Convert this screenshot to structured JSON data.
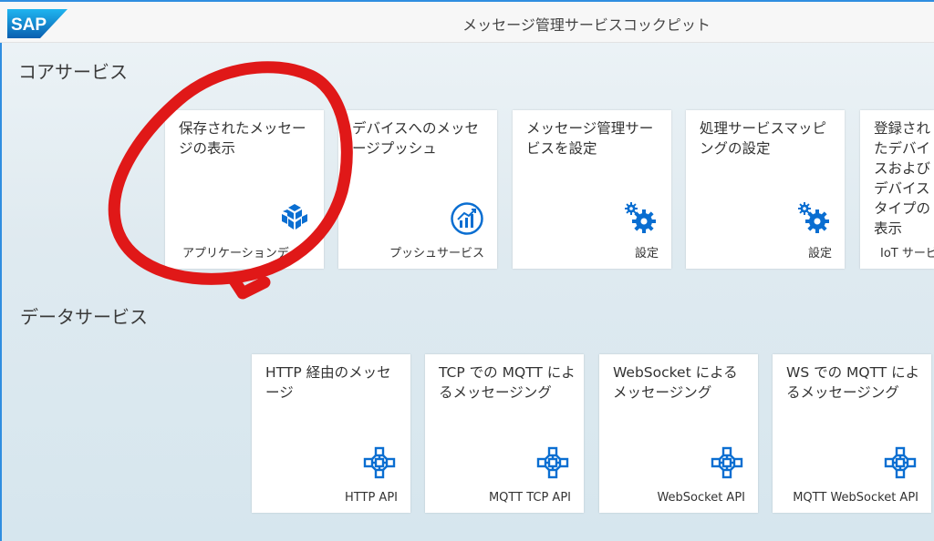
{
  "shell": {
    "logo_text": "SAP",
    "title": "メッセージ管理サービスコックピット"
  },
  "sections": {
    "core": "コアサービス",
    "data": "データサービス"
  },
  "tiles": [
    {
      "title": "保存されたメッセージの表示",
      "footer": "アプリケーションデ...",
      "icon": "cube-icon"
    },
    {
      "title": "デバイスへのメッセージプッシュ",
      "footer": "プッシュサービス",
      "icon": "chart-up-icon"
    },
    {
      "title": "メッセージ管理サービスを設定",
      "footer": "設定",
      "icon": "gears-icon"
    },
    {
      "title": "処理サービスマッピングの設定",
      "footer": "設定",
      "icon": "gears-icon"
    },
    {
      "title": "登録されたデバイスおよびデバイスタイプの表示",
      "footer": "IoT サービス",
      "icon": "gears-icon"
    },
    {
      "title": "HTTP 経由のメッセージ",
      "footer": "HTTP API",
      "icon": "network-icon"
    },
    {
      "title": "TCP での MQTT によるメッセージング",
      "footer": "MQTT TCP API",
      "icon": "network-icon"
    },
    {
      "title": "WebSocket によるメッセージング",
      "footer": "WebSocket API",
      "icon": "network-icon"
    },
    {
      "title": "WS での MQTT によるメッセージング",
      "footer": "MQTT WebSocket API",
      "icon": "network-icon"
    }
  ],
  "colors": {
    "accent": "#2f8ee0",
    "icon": "#0a6ed1",
    "annotation": "#e01818"
  }
}
